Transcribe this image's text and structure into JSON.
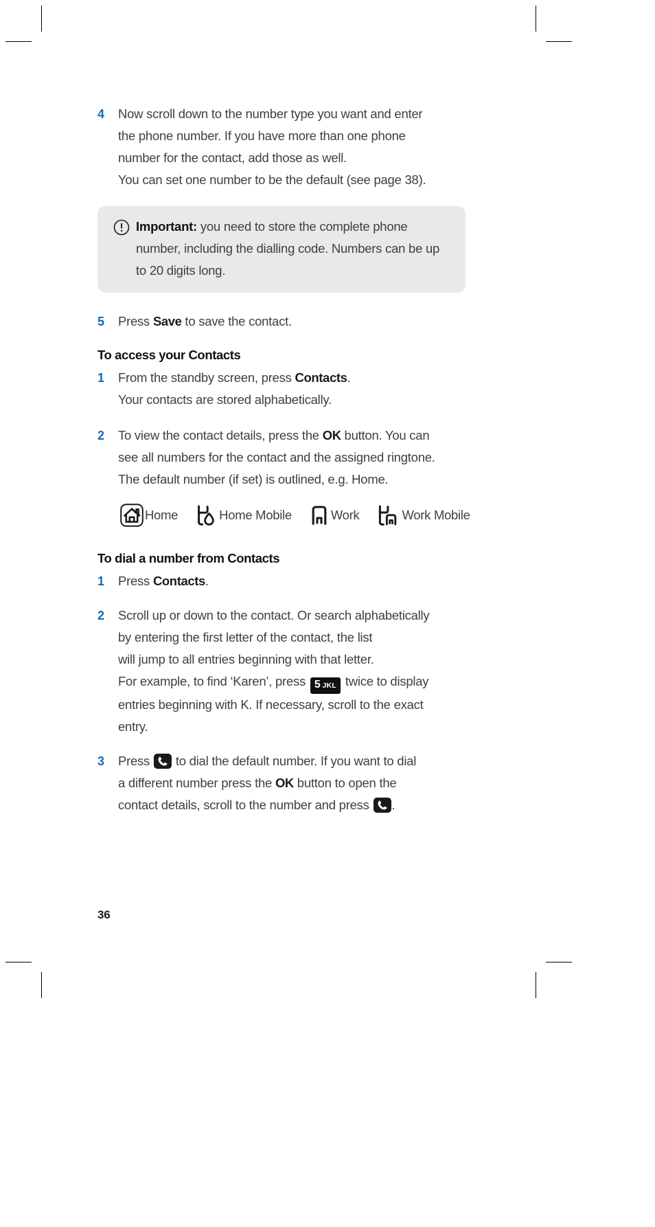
{
  "page": {
    "folio": "36"
  },
  "steps_continued": [
    {
      "number": "4",
      "lines": [
        "Now scroll down to the number type you want and enter",
        "the phone number. If you have more than one phone",
        "number for the contact, add those as well.",
        "You can set one number to be the default  (see page 38)."
      ]
    }
  ],
  "callout": {
    "icon": "exclamation-circle-icon",
    "label": "Important:",
    "lines": [
      " you need to store the complete phone",
      "number, including the dialling code. Numbers can be",
      "up to 20 digits long."
    ]
  },
  "step5": {
    "number": "5",
    "pre": "Press ",
    "ui": "Save",
    "post": " to save the contact."
  },
  "section_access": {
    "heading": "To access your Contacts",
    "step1": {
      "number": "1",
      "pre": "From the standby screen, press ",
      "ui": "Contacts",
      "post": ".",
      "line2": "Your contacts are stored alphabetically."
    },
    "step2": {
      "number": "2",
      "pre": "To view the contact details, press the ",
      "ui": "OK",
      "post": " button. You can",
      "line2": "see all numbers for the contact and the assigned ringtone.",
      "line3": "The default number (if set) is outlined, e.g. Home."
    }
  },
  "legend": {
    "items": [
      {
        "icon": "home-outlined-icon",
        "label": "Home",
        "default": true
      },
      {
        "icon": "home-mobile-icon",
        "label": "Home Mobile",
        "default": false
      },
      {
        "icon": "work-icon",
        "label": "Work",
        "default": false
      },
      {
        "icon": "work-mobile-icon",
        "label": "Work Mobile",
        "default": false
      }
    ]
  },
  "section_dial": {
    "heading": "To dial a number from Contacts",
    "step1": {
      "number": "1",
      "pre": "Press ",
      "ui": "Contacts",
      "post": "."
    },
    "step2": {
      "number": "2",
      "line1": "Scroll up or down to the contact. Or search alphabetically",
      "line2": "by entering the first letter of the contact, the list",
      "line3": "will jump to all entries beginning with that letter.",
      "line4_pre": "For example, to find ‘Karen’, press ",
      "keycap": {
        "number": "5",
        "letters": "JKL",
        "icon": "keypad-5-icon"
      },
      "line4_post": " twice to display",
      "line5": "entries beginning with K. If necessary, scroll to the exact",
      "line6": "entry."
    },
    "step3": {
      "number": "3",
      "pre": "Press ",
      "icon1": "call-key-icon",
      "mid1": " to dial the default number. If you want to dial",
      "line2_pre": "a different number press the ",
      "ui": "OK",
      "line2_post": " button to open the",
      "line3_pre": "contact details, scroll to the number and press ",
      "icon2": "call-key-icon",
      "line3_post": "."
    }
  },
  "colors": {
    "step_number": "#1668b3",
    "body_text": "#3f3f3f",
    "heading_text": "#111111",
    "callout_bg": "#e9e9e9",
    "keycap_bg": "#111111"
  }
}
